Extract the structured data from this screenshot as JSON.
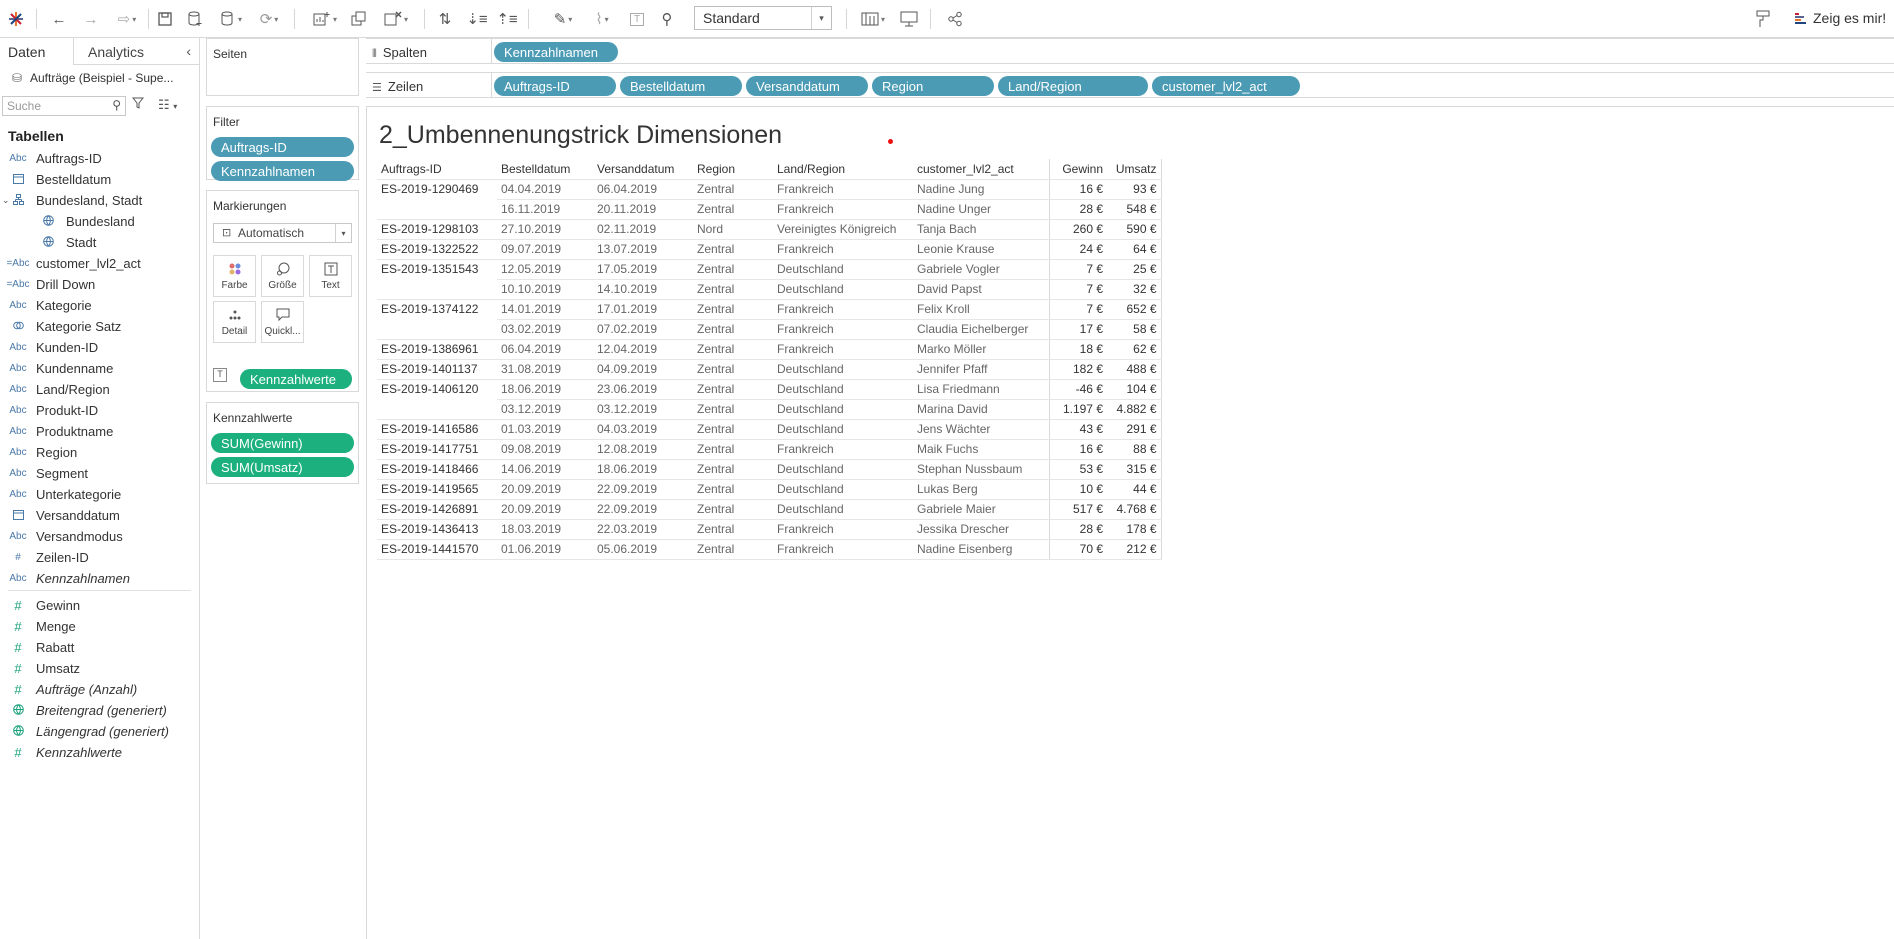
{
  "toolbar": {
    "view_select": "Standard",
    "show_me": "Zeig es mir!"
  },
  "datapane": {
    "tab_data": "Daten",
    "tab_analytics": "Analytics",
    "datasource": "Aufträge (Beispiel - Supe...",
    "search_placeholder": "Suche",
    "tables_heading": "Tabellen",
    "dimensions": [
      {
        "icon": "Abc",
        "label": "Auftrags-ID"
      },
      {
        "icon": "calendar",
        "label": "Bestelldatum"
      },
      {
        "icon": "hierarchy",
        "label": "Bundesland, Stadt"
      },
      {
        "icon": "globe",
        "label": "Bundesland"
      },
      {
        "icon": "globe",
        "label": "Stadt"
      },
      {
        "icon": "=Abc",
        "label": "customer_lvl2_act"
      },
      {
        "icon": "=Abc",
        "label": "Drill Down"
      },
      {
        "icon": "Abc",
        "label": "Kategorie"
      },
      {
        "icon": "set",
        "label": "Kategorie Satz"
      },
      {
        "icon": "Abc",
        "label": "Kunden-ID"
      },
      {
        "icon": "Abc",
        "label": "Kundenname"
      },
      {
        "icon": "Abc",
        "label": "Land/Region"
      },
      {
        "icon": "Abc",
        "label": "Produkt-ID"
      },
      {
        "icon": "Abc",
        "label": "Produktname"
      },
      {
        "icon": "Abc",
        "label": "Region"
      },
      {
        "icon": "Abc",
        "label": "Segment"
      },
      {
        "icon": "Abc",
        "label": "Unterkategorie"
      },
      {
        "icon": "calendar",
        "label": "Versanddatum"
      },
      {
        "icon": "Abc",
        "label": "Versandmodus"
      },
      {
        "icon": "#",
        "label": "Zeilen-ID"
      },
      {
        "icon": "Abc",
        "label": "Kennzahlnamen"
      }
    ],
    "measures": [
      {
        "icon": "#",
        "label": "Gewinn"
      },
      {
        "icon": "#",
        "label": "Menge"
      },
      {
        "icon": "#",
        "label": "Rabatt"
      },
      {
        "icon": "#",
        "label": "Umsatz"
      },
      {
        "icon": "#",
        "label": "Aufträge (Anzahl)"
      },
      {
        "icon": "globe",
        "label": "Breitengrad (generiert)"
      },
      {
        "icon": "globe",
        "label": "Längengrad (generiert)"
      },
      {
        "icon": "#",
        "label": "Kennzahlwerte"
      }
    ]
  },
  "cards": {
    "pages_title": "Seiten",
    "filter_title": "Filter",
    "filters": [
      "Auftrags-ID",
      "Kennzahlnamen"
    ],
    "marks_title": "Markierungen",
    "marks_type": "Automatisch",
    "marks_buttons": [
      "Farbe",
      "Größe",
      "Text",
      "Detail",
      "Quickl..."
    ],
    "marks_text_pill": "Kennzahlwerte",
    "measure_values_title": "Kennzahlwerte",
    "measure_values": [
      "SUM(Gewinn)",
      "SUM(Umsatz)"
    ]
  },
  "shelves": {
    "columns_label": "Spalten",
    "rows_label": "Zeilen",
    "columns": [
      "Kennzahlnamen"
    ],
    "rows": [
      "Auftrags-ID",
      "Bestelldatum",
      "Versanddatum",
      "Region",
      "Land/Region",
      "customer_lvl2_act"
    ]
  },
  "view": {
    "title": "2_Umbennenungstrick Dimensionen",
    "headers": [
      "Auftrags-ID",
      "Bestelldatum",
      "Versanddatum",
      "Region",
      "Land/Region",
      "customer_lvl2_act",
      "Gewinn",
      "Umsatz"
    ],
    "rows": [
      [
        "ES-2019-1290469",
        "04.04.2019",
        "06.04.2019",
        "Zentral",
        "Frankreich",
        "Nadine Jung",
        "16 €",
        "93 €"
      ],
      [
        "",
        "16.11.2019",
        "20.11.2019",
        "Zentral",
        "Frankreich",
        "Nadine Unger",
        "28 €",
        "548 €"
      ],
      [
        "ES-2019-1298103",
        "27.10.2019",
        "02.11.2019",
        "Nord",
        "Vereinigtes Königreich",
        "Tanja Bach",
        "260 €",
        "590 €"
      ],
      [
        "ES-2019-1322522",
        "09.07.2019",
        "13.07.2019",
        "Zentral",
        "Frankreich",
        "Leonie Krause",
        "24 €",
        "64 €"
      ],
      [
        "ES-2019-1351543",
        "12.05.2019",
        "17.05.2019",
        "Zentral",
        "Deutschland",
        "Gabriele Vogler",
        "7 €",
        "25 €"
      ],
      [
        "",
        "10.10.2019",
        "14.10.2019",
        "Zentral",
        "Deutschland",
        "David Papst",
        "7 €",
        "32 €"
      ],
      [
        "ES-2019-1374122",
        "14.01.2019",
        "17.01.2019",
        "Zentral",
        "Frankreich",
        "Felix Kroll",
        "7 €",
        "652 €"
      ],
      [
        "",
        "03.02.2019",
        "07.02.2019",
        "Zentral",
        "Frankreich",
        "Claudia Eichelberger",
        "17 €",
        "58 €"
      ],
      [
        "ES-2019-1386961",
        "06.04.2019",
        "12.04.2019",
        "Zentral",
        "Frankreich",
        "Marko Möller",
        "18 €",
        "62 €"
      ],
      [
        "ES-2019-1401137",
        "31.08.2019",
        "04.09.2019",
        "Zentral",
        "Deutschland",
        "Jennifer Pfaff",
        "182 €",
        "488 €"
      ],
      [
        "ES-2019-1406120",
        "18.06.2019",
        "23.06.2019",
        "Zentral",
        "Deutschland",
        "Lisa Friedmann",
        "-46 €",
        "104 €"
      ],
      [
        "",
        "03.12.2019",
        "03.12.2019",
        "Zentral",
        "Deutschland",
        "Marina David",
        "1.197 €",
        "4.882 €"
      ],
      [
        "ES-2019-1416586",
        "01.03.2019",
        "04.03.2019",
        "Zentral",
        "Deutschland",
        "Jens Wächter",
        "43 €",
        "291 €"
      ],
      [
        "ES-2019-1417751",
        "09.08.2019",
        "12.08.2019",
        "Zentral",
        "Frankreich",
        "Maik Fuchs",
        "16 €",
        "88 €"
      ],
      [
        "ES-2019-1418466",
        "14.06.2019",
        "18.06.2019",
        "Zentral",
        "Deutschland",
        "Stephan Nussbaum",
        "53 €",
        "315 €"
      ],
      [
        "ES-2019-1419565",
        "20.09.2019",
        "22.09.2019",
        "Zentral",
        "Deutschland",
        "Lukas Berg",
        "10 €",
        "44 €"
      ],
      [
        "ES-2019-1426891",
        "20.09.2019",
        "22.09.2019",
        "Zentral",
        "Deutschland",
        "Gabriele Maier",
        "517 €",
        "4.768 €"
      ],
      [
        "ES-2019-1436413",
        "18.03.2019",
        "22.03.2019",
        "Zentral",
        "Frankreich",
        "Jessika Drescher",
        "28 €",
        "178 €"
      ],
      [
        "ES-2019-1441570",
        "01.06.2019",
        "05.06.2019",
        "Zentral",
        "Frankreich",
        "Nadine Eisenberg",
        "70 €",
        "212 €"
      ]
    ]
  }
}
